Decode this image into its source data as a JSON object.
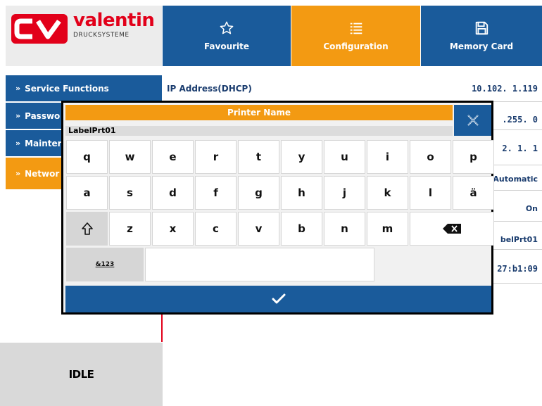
{
  "header": {
    "logo_name": "valentin",
    "logo_sub": "DRUCKSYSTEME",
    "tabs": [
      {
        "label": "Favourite",
        "icon": "star-icon"
      },
      {
        "label": "Configuration",
        "icon": "list-icon"
      },
      {
        "label": "Memory Card",
        "icon": "save-icon"
      }
    ]
  },
  "sidebar": {
    "items": [
      {
        "label": "Service Functions"
      },
      {
        "label": "Passwo"
      },
      {
        "label": "Mainter"
      },
      {
        "label": "Networ"
      }
    ],
    "status": "IDLE"
  },
  "content": {
    "rows": [
      {
        "label": "IP Address(DHCP)",
        "value": "10.102.  1.119"
      },
      {
        "value": ".255.  0"
      },
      {
        "value": "2.  1.  1"
      },
      {
        "value": "Automatic"
      },
      {
        "value": "On"
      },
      {
        "value": "belPrt01"
      },
      {
        "value": "27:b1:09"
      }
    ]
  },
  "dialog": {
    "title": "Printer Name",
    "input_value": "LabelPrt01",
    "rows": [
      [
        "q",
        "w",
        "e",
        "r",
        "t",
        "y",
        "u",
        "i",
        "o",
        "p"
      ],
      [
        "a",
        "s",
        "d",
        "f",
        "g",
        "h",
        "j",
        "k",
        "l",
        "ä"
      ],
      [
        "z",
        "x",
        "c",
        "v",
        "b",
        "n",
        "m"
      ]
    ],
    "symbols_label": "&123"
  },
  "colors": {
    "blue": "#1a5b9b",
    "orange": "#f39a12",
    "red": "#e2001a"
  }
}
